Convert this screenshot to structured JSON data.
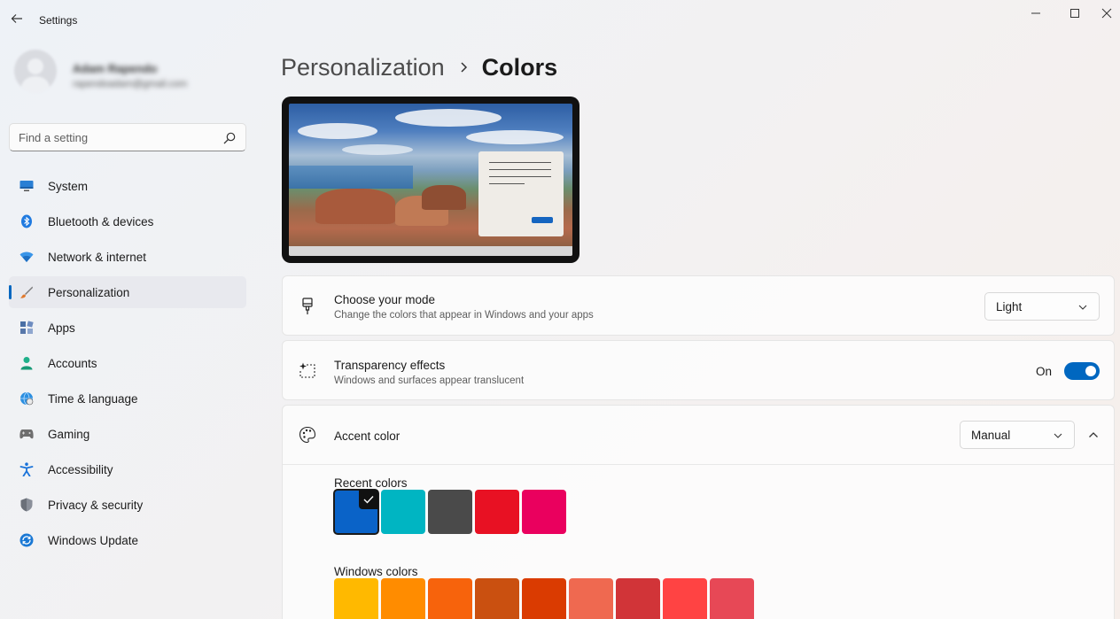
{
  "window": {
    "title": "Settings"
  },
  "profile": {
    "name": "Adam Rapendo",
    "email": "rapendoadam@gmail.com"
  },
  "search": {
    "placeholder": "Find a setting"
  },
  "sidebar": {
    "items": [
      {
        "label": "System",
        "icon": "monitor-icon"
      },
      {
        "label": "Bluetooth & devices",
        "icon": "bluetooth-icon"
      },
      {
        "label": "Network & internet",
        "icon": "wifi-icon"
      },
      {
        "label": "Personalization",
        "icon": "brush-icon",
        "active": true
      },
      {
        "label": "Apps",
        "icon": "apps-icon"
      },
      {
        "label": "Accounts",
        "icon": "person-icon"
      },
      {
        "label": "Time & language",
        "icon": "globe-clock-icon"
      },
      {
        "label": "Gaming",
        "icon": "gamepad-icon"
      },
      {
        "label": "Accessibility",
        "icon": "accessibility-icon"
      },
      {
        "label": "Privacy & security",
        "icon": "shield-icon"
      },
      {
        "label": "Windows Update",
        "icon": "update-icon"
      }
    ]
  },
  "breadcrumb": {
    "parent": "Personalization",
    "current": "Colors"
  },
  "mode": {
    "title": "Choose your mode",
    "subtitle": "Change the colors that appear in Windows and your apps",
    "value": "Light"
  },
  "transparency": {
    "title": "Transparency effects",
    "subtitle": "Windows and surfaces appear translucent",
    "state_label": "On",
    "enabled": true
  },
  "accent": {
    "title": "Accent color",
    "value": "Manual",
    "recent_label": "Recent colors",
    "recent_colors": [
      "#0a63c8",
      "#00b5c2",
      "#4a4a4a",
      "#e81123",
      "#ea005e"
    ],
    "selected_index": 0,
    "windows_label": "Windows colors",
    "windows_colors": [
      "#ffb900",
      "#ff8c00",
      "#f7630c",
      "#ca5010",
      "#da3b01",
      "#ef6950",
      "#d13438",
      "#ff4343",
      "#e74856"
    ]
  },
  "colors": {
    "accent": "#0067c0"
  }
}
